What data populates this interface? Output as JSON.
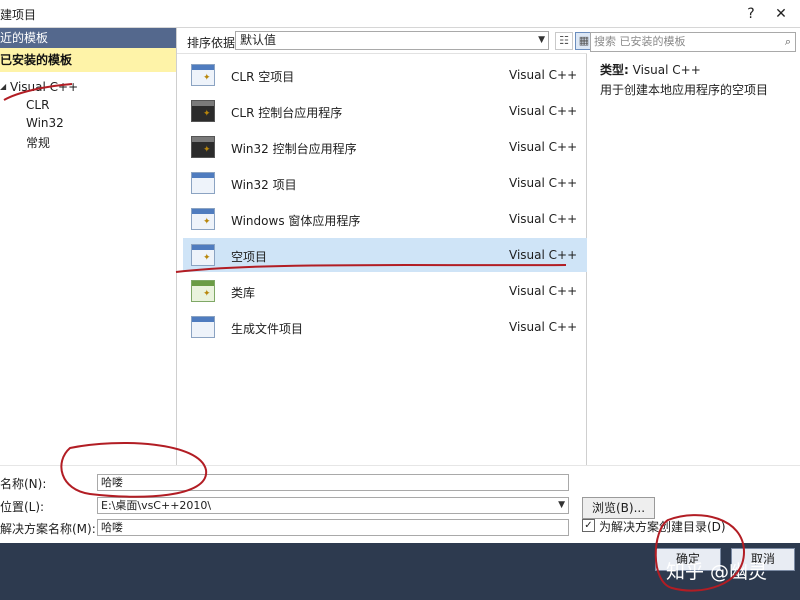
{
  "dialog": {
    "title": "建项目",
    "help_glyph": "?",
    "close_glyph": "✕"
  },
  "sidebar": {
    "recent_label": "近的模板",
    "installed_label": "已安装的模板",
    "tree": {
      "root": "Visual C++",
      "children": [
        "CLR",
        "Win32",
        "常规"
      ]
    }
  },
  "toolbar": {
    "sort_label": "排序依据:",
    "sort_value": "默认值"
  },
  "templates": [
    {
      "name": "CLR 空项目",
      "lang": "Visual C++",
      "selected": false
    },
    {
      "name": "CLR 控制台应用程序",
      "lang": "Visual C++",
      "selected": false
    },
    {
      "name": "Win32 控制台应用程序",
      "lang": "Visual C++",
      "selected": false
    },
    {
      "name": "Win32 项目",
      "lang": "Visual C++",
      "selected": false
    },
    {
      "name": "Windows 窗体应用程序",
      "lang": "Visual C++",
      "selected": false
    },
    {
      "name": "空项目",
      "lang": "Visual C++",
      "selected": true
    },
    {
      "name": "类库",
      "lang": "Visual C++",
      "selected": false
    },
    {
      "name": "生成文件项目",
      "lang": "Visual C++",
      "selected": false
    }
  ],
  "search": {
    "placeholder": "搜索 已安装的模板"
  },
  "details": {
    "type_label": "类型:",
    "type_value": "Visual C++",
    "description": "用于创建本地应用程序的空项目"
  },
  "form": {
    "name_label": "名称(N):",
    "name_value": "哈喽",
    "location_label": "位置(L):",
    "location_value": "E:\\桌面\\vsC++2010\\",
    "solution_label": "解决方案名称(M):",
    "solution_value": "哈喽",
    "browse_label": "浏览(B)...",
    "create_dir_label": "为解决方案创建目录(D)",
    "create_dir_checked": true
  },
  "footer": {
    "ok_label": "确定",
    "cancel_label": "取消",
    "watermark": "知乎 @幽灵"
  },
  "colors": {
    "selection": "#cfe4f7",
    "installed_header": "#fef3a8",
    "recent_header": "#54688d",
    "footer": "#2d3a4f",
    "annotation": "#b21d24"
  }
}
